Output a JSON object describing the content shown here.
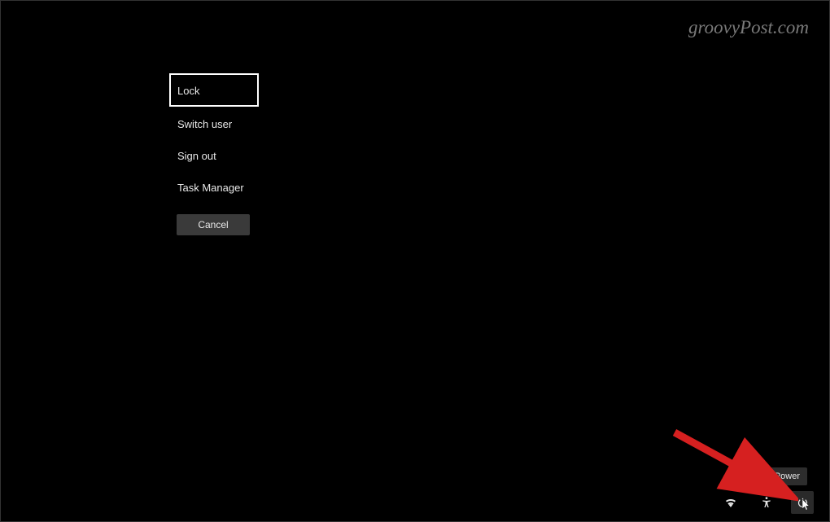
{
  "watermark": "groovyPost.com",
  "menu": {
    "items": [
      {
        "label": "Lock",
        "selected": true
      },
      {
        "label": "Switch user",
        "selected": false
      },
      {
        "label": "Sign out",
        "selected": false
      },
      {
        "label": "Task Manager",
        "selected": false
      }
    ],
    "cancel_label": "Cancel"
  },
  "tooltip": {
    "power": "Power"
  },
  "tray": {
    "wifi_icon": "wifi-icon",
    "accessibility_icon": "accessibility-icon",
    "power_icon": "power-icon"
  }
}
